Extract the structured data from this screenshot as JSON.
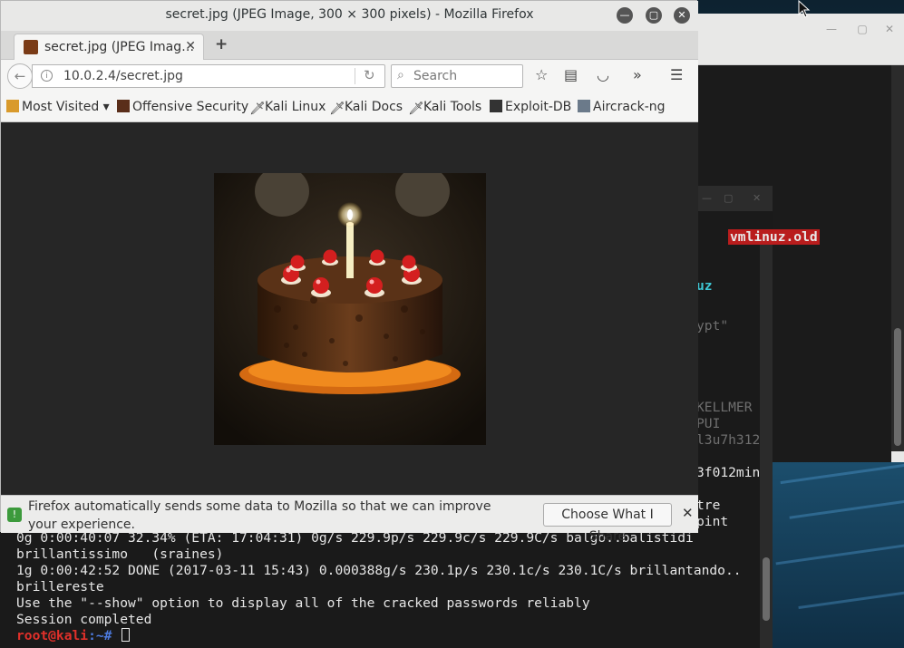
{
  "firefox": {
    "window_title": "secret.jpg (JPEG Image, 300 × 300 pixels) - Mozilla Firefox",
    "tab_label": "secret.jpg (JPEG Imag…",
    "url": "10.0.2.4/secret.jpg",
    "search_placeholder": "Search",
    "bookmarks": [
      {
        "label": "Most Visited ▾",
        "icon": "most-visited-icon"
      },
      {
        "label": "Offensive Security",
        "icon": "offensive-security-icon"
      },
      {
        "label": "Kali Linux",
        "icon": "kali-icon"
      },
      {
        "label": "Kali Docs",
        "icon": "kali-icon"
      },
      {
        "label": "Kali Tools",
        "icon": "kali-icon"
      },
      {
        "label": "Exploit-DB",
        "icon": "exploit-db-icon"
      },
      {
        "label": "Aircrack-ng",
        "icon": "aircrack-icon"
      }
    ],
    "notification": {
      "text": "Firefox automatically sends some data to Mozilla so that we can improve your experience.",
      "button": "Choose What I Share"
    }
  },
  "terminal": {
    "side_fragments": {
      "highlight": "vmlinuz.old",
      "uz": "uz",
      "ypt": "ypt\"",
      "kellmer": "KELLMER",
      "pui": "PUI",
      "l3u7h312": "l3u7h312",
      "f012min": "3f012min",
      "tre": "tre",
      "pint": "pint"
    },
    "lines": [
      "0g 0:00:40:07 32.34% (ETA: 17:04:31) 0g/s 229.9p/s 229.9c/s 229.9C/s balgo..balistidi",
      "brillantissimo   (sraines)",
      "1g 0:00:42:52 DONE (2017-03-11 15:43) 0.000388g/s 230.1p/s 230.1c/s 230.1C/s brillantando..",
      "brillereste",
      "Use the \"--show\" option to display all of the cracked passwords reliably",
      "Session completed"
    ],
    "prompt_user": "root@kali",
    "prompt_path": ":~# "
  }
}
